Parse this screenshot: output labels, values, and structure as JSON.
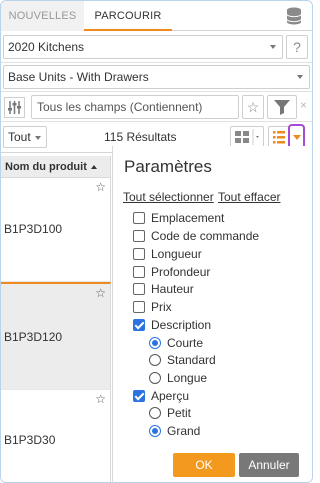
{
  "tabs": [
    {
      "label": "NOUVELLES",
      "active": false
    },
    {
      "label": "PARCOURIR",
      "active": true
    }
  ],
  "header": {
    "db_icon": "database-icon"
  },
  "catalog_select": {
    "value": "2020 Kitchens",
    "help_label": "?"
  },
  "category_select": {
    "value": "Base Units - With Drawers"
  },
  "search": {
    "placeholder": "Tous les champs (Contiennent)",
    "star_label": "☆",
    "clear_label": "×"
  },
  "toolbar": {
    "filter_value": "Tout",
    "results_text": "115 Résultats"
  },
  "list": {
    "column_header": "Nom du produit",
    "products": [
      {
        "name": "B1P3D100",
        "selected": false
      },
      {
        "name": "B1P3D120",
        "selected": true
      },
      {
        "name": "B1P3D30",
        "selected": false
      }
    ],
    "star_glyph": "☆"
  },
  "settings": {
    "title": "Paramètres",
    "select_all": "Tout sélectionner",
    "clear_all": "Tout effacer",
    "fields": [
      {
        "label": "Emplacement",
        "checked": false
      },
      {
        "label": "Code de commande",
        "checked": false
      },
      {
        "label": "Longueur",
        "checked": false
      },
      {
        "label": "Profondeur",
        "checked": false
      },
      {
        "label": "Hauteur",
        "checked": false
      },
      {
        "label": "Prix",
        "checked": false
      },
      {
        "label": "Description",
        "checked": true
      }
    ],
    "description_options": [
      {
        "label": "Courte",
        "selected": true
      },
      {
        "label": "Standard",
        "selected": false
      },
      {
        "label": "Longue",
        "selected": false
      }
    ],
    "preview": {
      "label": "Aperçu",
      "checked": true
    },
    "preview_options": [
      {
        "label": "Petit",
        "selected": false
      },
      {
        "label": "Grand",
        "selected": true
      }
    ],
    "ok_label": "OK",
    "cancel_label": "Annuler"
  },
  "colors": {
    "accent": "#ee8a1f",
    "checkbox": "#2a73e0",
    "highlight": "#a44ad6",
    "cancel": "#787878"
  }
}
